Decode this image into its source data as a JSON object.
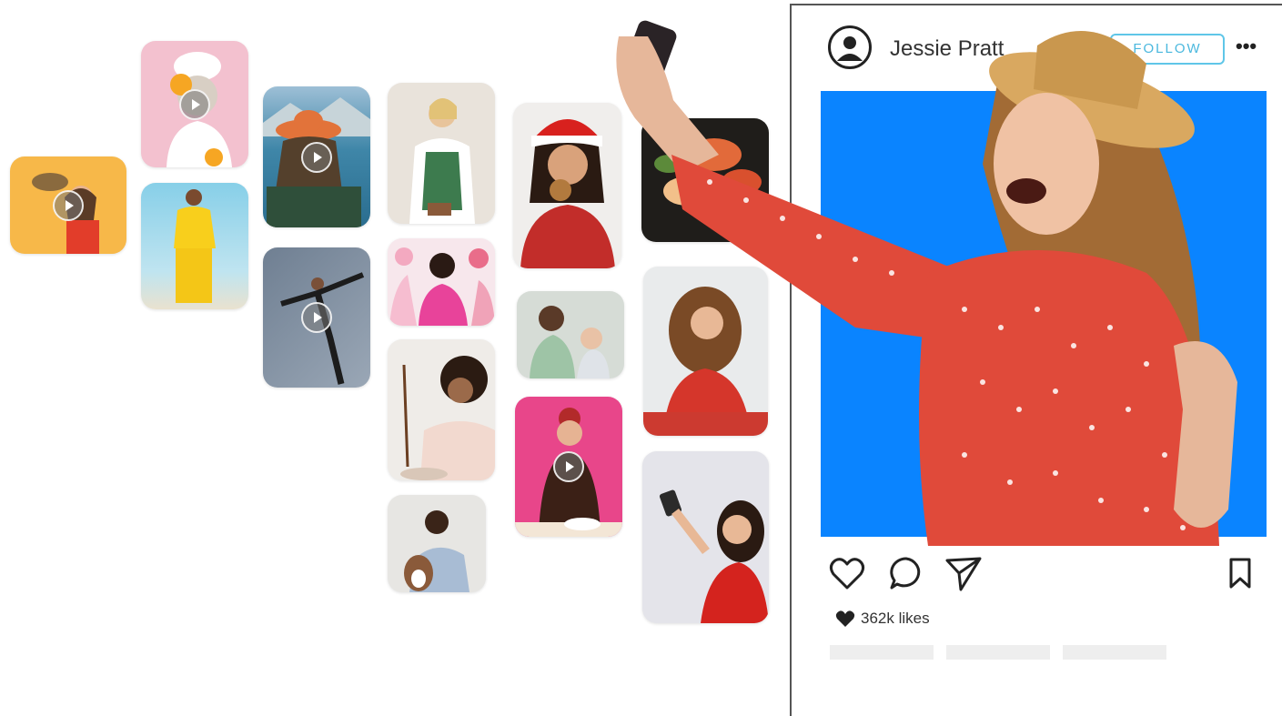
{
  "profile": {
    "username": "Jessie Pratt",
    "follow_label": "FOLLOW",
    "more_icon": "more-horizontal-icon"
  },
  "post": {
    "likes_label": "362k likes",
    "photo_background": "#0a84ff",
    "accent": "#5fc6e8"
  },
  "icons": [
    "heart-icon",
    "comment-icon",
    "send-icon",
    "bookmark-icon"
  ],
  "tiles": [
    {
      "name": "tile-hat-woman",
      "video": true
    },
    {
      "name": "tile-facemask-woman",
      "video": true
    },
    {
      "name": "tile-yellow-outfit",
      "video": false
    },
    {
      "name": "tile-lake-hat",
      "video": true
    },
    {
      "name": "tile-yoga-pose",
      "video": true
    },
    {
      "name": "tile-apron-cook",
      "video": false
    },
    {
      "name": "tile-pink-jacket",
      "video": false
    },
    {
      "name": "tile-chocolate-drip",
      "video": false
    },
    {
      "name": "tile-dog-portrait",
      "video": false
    },
    {
      "name": "tile-santa-cookie",
      "video": false
    },
    {
      "name": "tile-mother-baby",
      "video": false
    },
    {
      "name": "tile-baking-pink",
      "video": true
    },
    {
      "name": "tile-food-platter",
      "video": false
    },
    {
      "name": "tile-curly-woman-eating",
      "video": false
    },
    {
      "name": "tile-selfie-woman",
      "video": false
    }
  ]
}
